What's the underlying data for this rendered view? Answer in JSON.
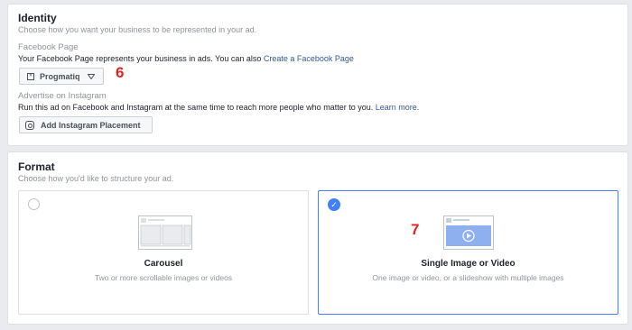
{
  "identity": {
    "title": "Identity",
    "subtitle": "Choose how you want your business to be represented in your ad.",
    "facebook_page": {
      "label": "Facebook Page",
      "description": "Your Facebook Page represents your business in ads. You can also ",
      "create_link": "Create a Facebook Page",
      "selected_page": "Progmatiq"
    },
    "instagram": {
      "label": "Advertise on Instagram",
      "description": "Run this ad on Facebook and Instagram at the same time to reach more people who matter to you. ",
      "learn_more": "Learn more.",
      "button_label": "Add Instagram Placement"
    }
  },
  "format": {
    "title": "Format",
    "subtitle": "Choose how you'd like to structure your ad.",
    "options": [
      {
        "title": "Carousel",
        "description": "Two or more scrollable images or videos",
        "selected": false
      },
      {
        "title": "Single Image or Video",
        "description": "One image or video, or a slideshow with multiple images",
        "selected": true
      }
    ]
  },
  "annotations": {
    "step_page": "6",
    "step_format": "7"
  },
  "colors": {
    "accent": "#4080ff",
    "link": "#365899",
    "annotation": "#e02424"
  },
  "icons": {
    "page": "page-icon",
    "dropdown": "caret-down-icon",
    "instagram": "instagram-icon",
    "checked": "check-icon"
  }
}
